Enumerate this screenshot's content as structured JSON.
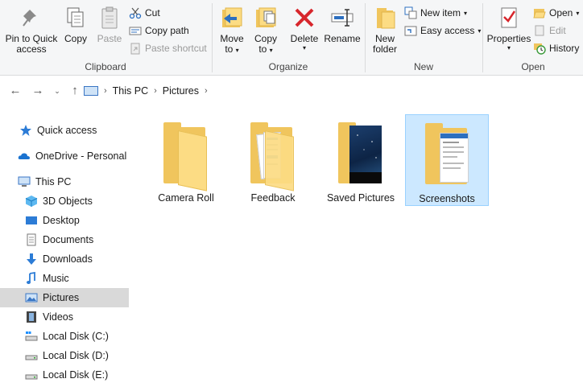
{
  "ribbon": {
    "clipboard": {
      "label": "Clipboard",
      "pin_label_1": "Pin to Quick",
      "pin_label_2": "access",
      "copy_label": "Copy",
      "paste_label": "Paste",
      "cut_label": "Cut",
      "copy_path_label": "Copy path",
      "paste_shortcut_label": "Paste shortcut"
    },
    "organize": {
      "label": "Organize",
      "move_to_label": "Move",
      "move_to_label_2": "to",
      "copy_to_label": "Copy",
      "copy_to_label_2": "to",
      "delete_label": "Delete",
      "rename_label": "Rename"
    },
    "new": {
      "label": "New",
      "new_folder_label_1": "New",
      "new_folder_label_2": "folder",
      "new_item_label": "New item",
      "easy_access_label": "Easy access"
    },
    "open": {
      "label": "Open",
      "properties_label": "Properties",
      "open_label": "Open",
      "edit_label": "Edit",
      "history_label": "History"
    }
  },
  "address": {
    "crumbs": [
      "This PC",
      "Pictures"
    ]
  },
  "nav": {
    "items": [
      {
        "label": "Quick access",
        "icon": "star-icon"
      },
      {
        "label": "OneDrive - Personal",
        "icon": "cloud-icon"
      },
      {
        "label": "This PC",
        "icon": "computer-icon"
      },
      {
        "label": "3D Objects",
        "icon": "cube-icon"
      },
      {
        "label": "Desktop",
        "icon": "desktop-icon"
      },
      {
        "label": "Documents",
        "icon": "document-icon"
      },
      {
        "label": "Downloads",
        "icon": "download-arrow-icon"
      },
      {
        "label": "Music",
        "icon": "music-note-icon"
      },
      {
        "label": "Pictures",
        "icon": "pictures-icon"
      },
      {
        "label": "Videos",
        "icon": "film-icon"
      },
      {
        "label": "Local Disk (C:)",
        "icon": "disk-icon"
      },
      {
        "label": "Local Disk (D:)",
        "icon": "disk-icon"
      },
      {
        "label": "Local Disk (E:)",
        "icon": "disk-icon"
      }
    ],
    "selected": "Pictures"
  },
  "folders": [
    {
      "name": "Camera Roll"
    },
    {
      "name": "Feedback"
    },
    {
      "name": "Saved Pictures"
    },
    {
      "name": "Screenshots"
    }
  ],
  "colors": {
    "folder": "#f0c55d",
    "selection": "#cce8ff",
    "accent": "#0078d7"
  }
}
